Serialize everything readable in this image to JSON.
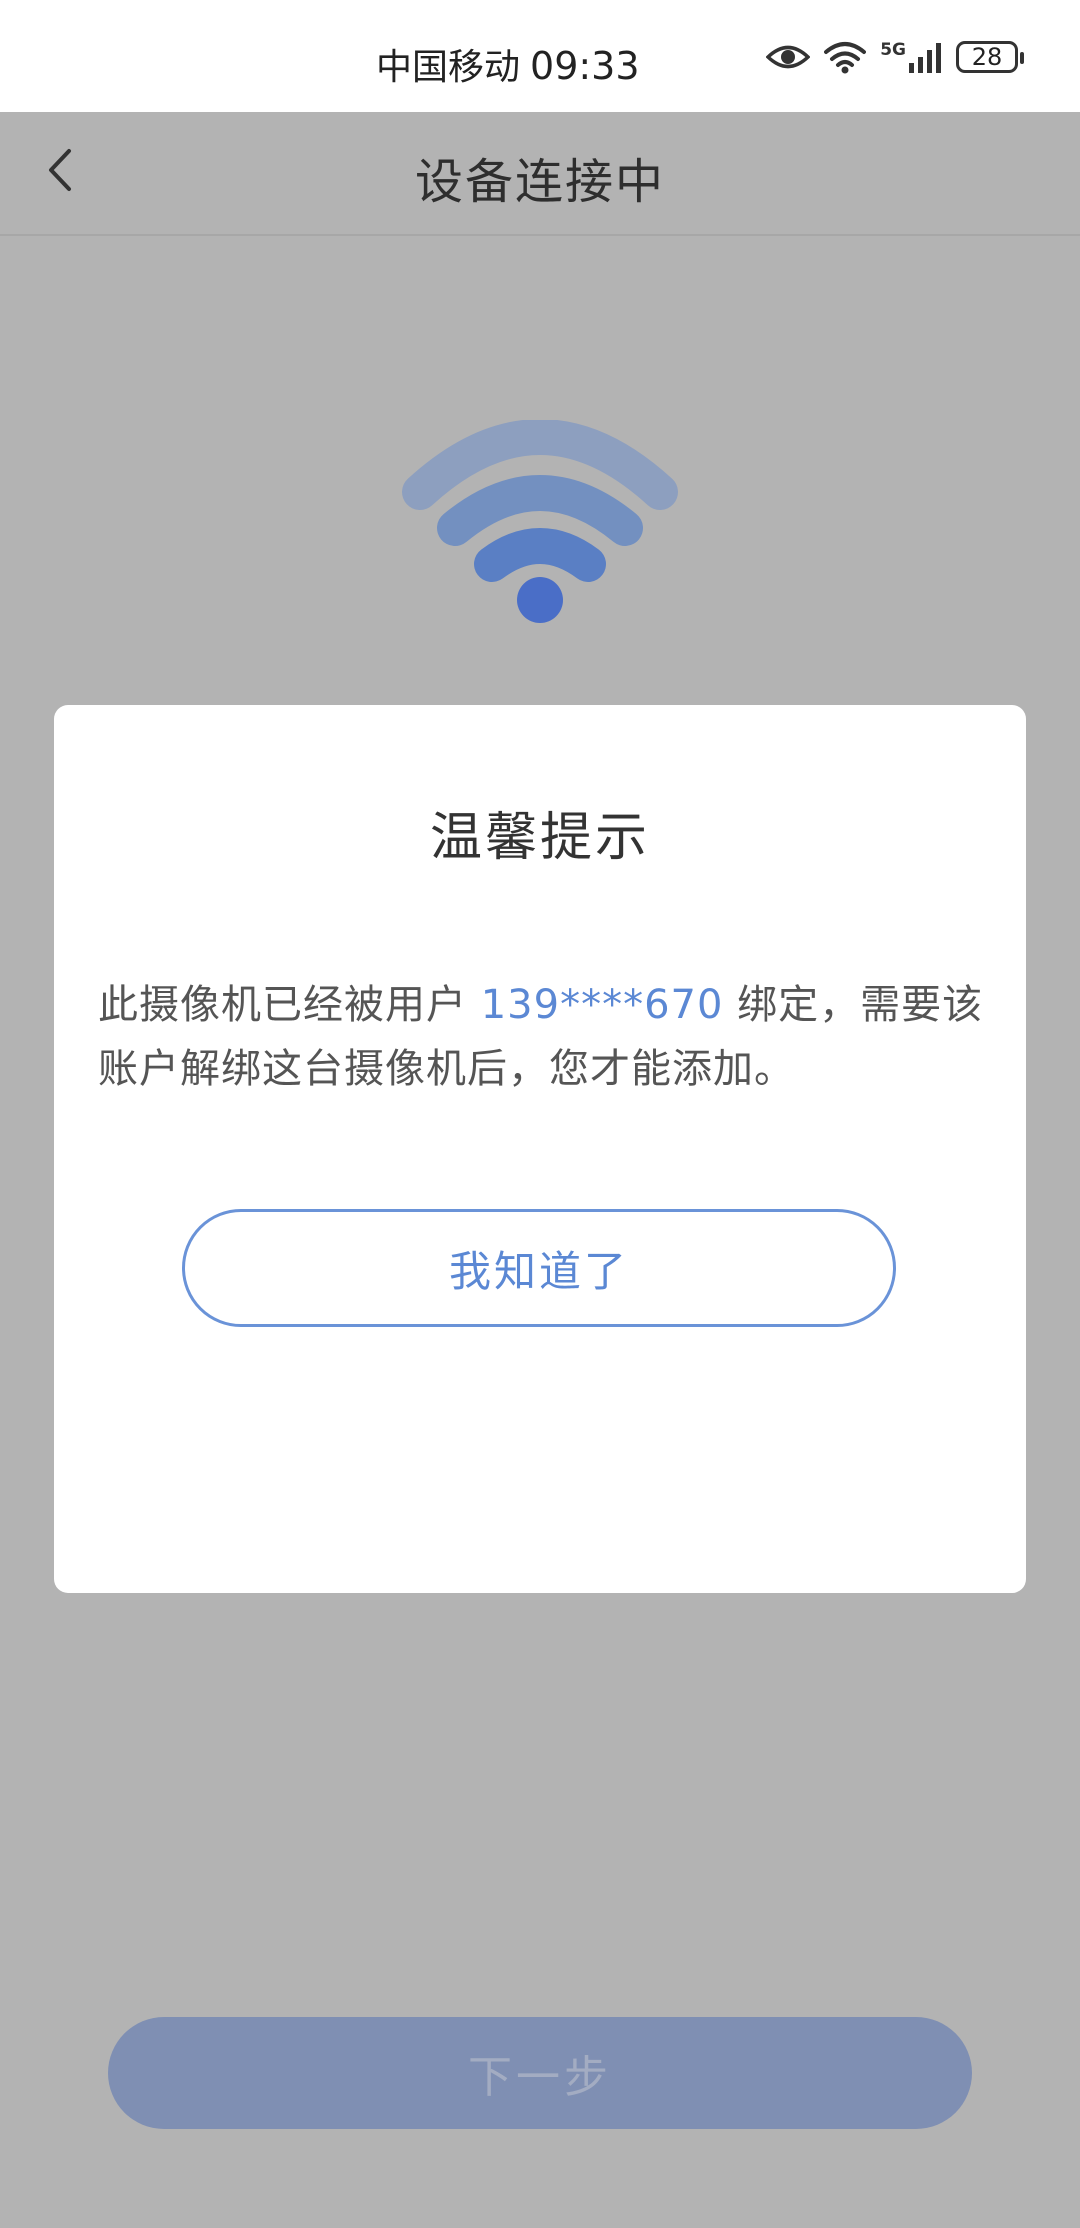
{
  "status_bar": {
    "carrier": "中国移动",
    "time": "09:33",
    "network": "5G",
    "battery": "28",
    "icons": [
      "eye-icon",
      "wifi-icon",
      "signal-icon",
      "battery-icon"
    ]
  },
  "app_bar": {
    "title": "设备连接中",
    "back_icon": "chevron-left-icon"
  },
  "illustration": {
    "icon": "wifi-icon",
    "colors": [
      "#8d9fbf",
      "#7390c0",
      "#5a7fc4",
      "#4a6ec7"
    ]
  },
  "dialog": {
    "title": "温馨提示",
    "message_prefix": "此摄像机已经被用户 ",
    "phone": "139****670",
    "message_suffix": " 绑定，需要该账户解绑这台摄像机后，您才能添加。",
    "ack_label": "我知道了"
  },
  "footer": {
    "next_label": "下一步"
  },
  "colors": {
    "accent": "#5b88d4",
    "overlay": "#b3b3b3",
    "next_button": "#7f8fb3"
  }
}
